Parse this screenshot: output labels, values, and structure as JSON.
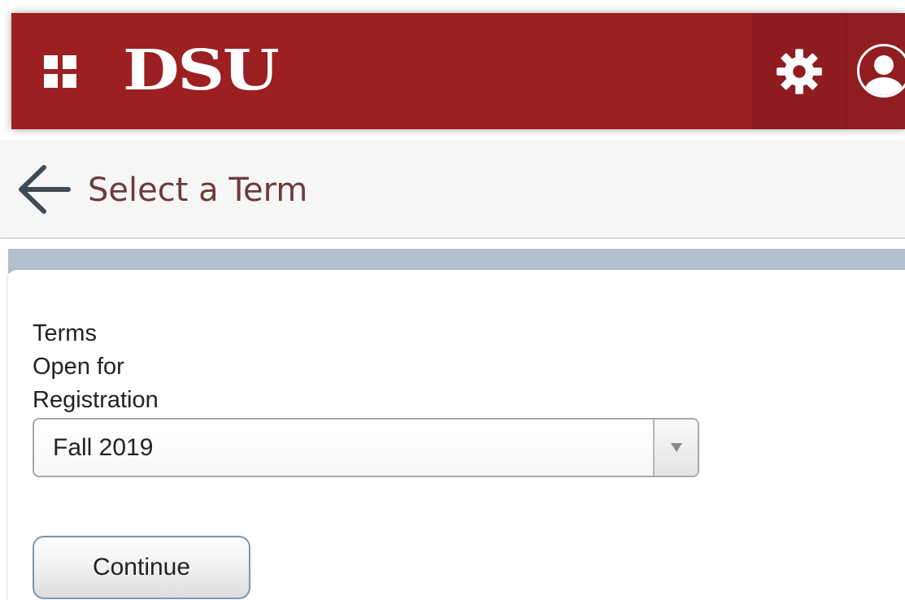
{
  "header": {
    "logo_text": "DSU",
    "brand_color": "#9c1f22",
    "apps_icon": "apps-grid-icon",
    "settings_icon": "gear-icon",
    "profile_icon": "user-avatar-icon"
  },
  "titlebar": {
    "back_icon": "arrow-left-icon",
    "title": "Select a Term"
  },
  "form": {
    "terms_label": "Terms\nOpen for\nRegistration",
    "term_select": {
      "selected": "Fall 2019",
      "arrow_icon": "caret-down-icon"
    },
    "continue_label": "Continue"
  }
}
